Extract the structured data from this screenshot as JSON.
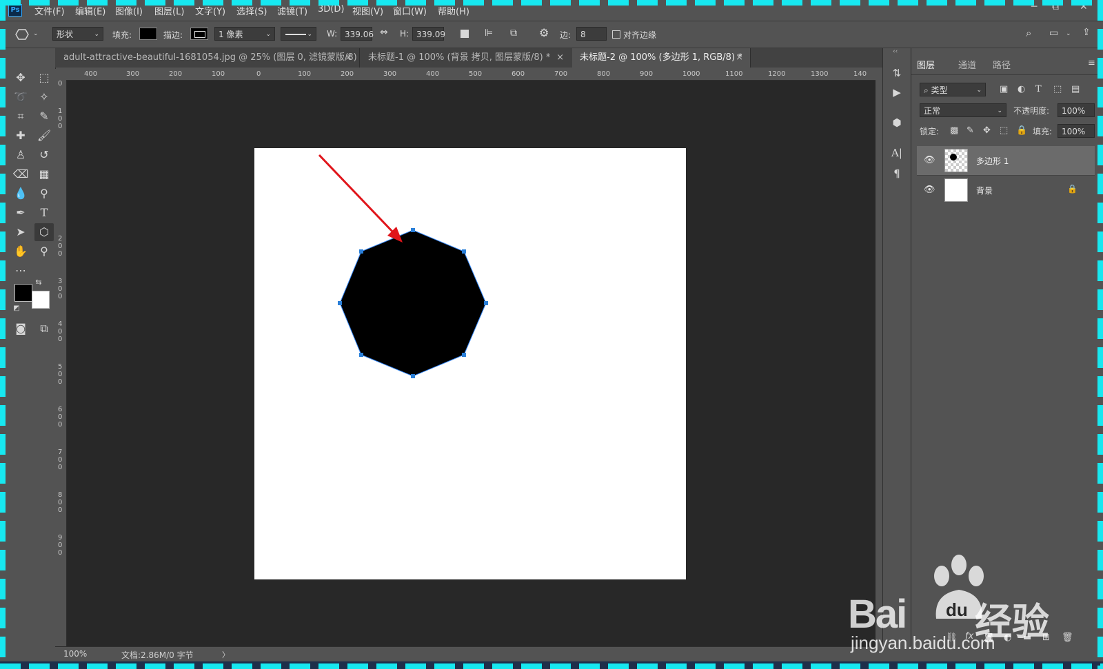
{
  "app": {
    "logo": "Ps"
  },
  "menu": [
    "文件(F)",
    "编辑(E)",
    "图像(I)",
    "图层(L)",
    "文字(Y)",
    "选择(S)",
    "滤镜(T)",
    "3D(D)",
    "视图(V)",
    "窗口(W)",
    "帮助(H)"
  ],
  "window_controls": {
    "minimize": "─",
    "restore": "⧉",
    "close": "✕"
  },
  "options": {
    "tool_icon": "hexagon-icon",
    "mode": "形状",
    "fill_label": "填充:",
    "fill_color": "#000000",
    "stroke_label": "描边:",
    "stroke_width": "1 像素",
    "w_label": "W:",
    "w_value": "339.06",
    "h_label": "H:",
    "h_value": "339.09",
    "sides_label": "边:",
    "sides_value": "8",
    "align_label": "对齐边缘"
  },
  "tabs": [
    {
      "label": "adult-attractive-beautiful-1681054.jpg  @  25% (图层 0, 滤镜蒙版/8) *"
    },
    {
      "label": "未标题-1 @ 100% (背景 拷贝, 图层蒙版/8) *"
    },
    {
      "label": "未标题-2 @ 100% (多边形 1, RGB/8) *",
      "active": true
    }
  ],
  "tab_close": "×",
  "ruler": {
    "top": [
      "400",
      "300",
      "200",
      "100",
      "0",
      "100",
      "200",
      "300",
      "400",
      "500",
      "600",
      "700",
      "800",
      "900",
      "1000",
      "1100",
      "1200",
      "1300",
      "140"
    ],
    "left": [
      "0",
      "1\n0\n0",
      "2\n0\n0",
      "3\n0\n0",
      "4\n0\n0",
      "5\n0\n0",
      "6\n0\n0",
      "7\n0\n0",
      "8\n0\n0",
      "9\n0\n0"
    ]
  },
  "layers_panel": {
    "tabs": [
      "图层",
      "通道",
      "路径"
    ],
    "filter_kind": "类型",
    "blend_mode": "正常",
    "opacity_label": "不透明度:",
    "opacity_value": "100%",
    "lock_label": "锁定:",
    "fill_label": "填充:",
    "fill_value": "100%",
    "layers": [
      {
        "name": "多边形 1",
        "selected": true
      },
      {
        "name": "背景",
        "locked": true
      }
    ]
  },
  "status": {
    "zoom": "100%",
    "doc": "文档:2.86M/0 字节",
    "arrow": "〉"
  },
  "watermark": {
    "text": "Bai",
    "text2": "经验",
    "url": "jingyan.baidu.com",
    "du": "du"
  },
  "colors": {
    "accent": "#31a8ff",
    "arrow": "#e0151b",
    "frame": "#17e8f0",
    "anchor": "#2a7fd8"
  }
}
